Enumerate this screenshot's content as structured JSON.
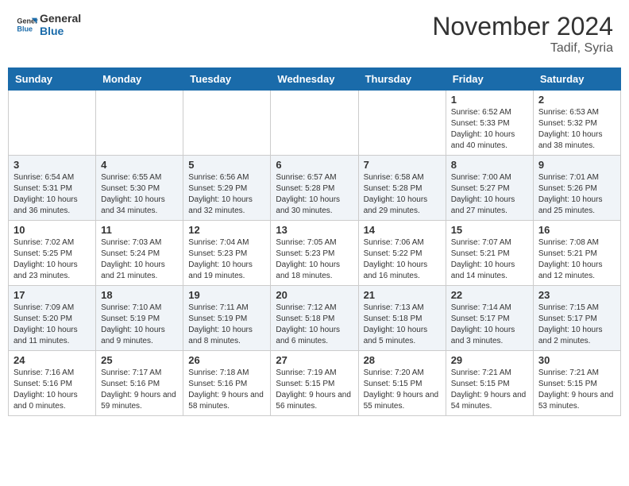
{
  "header": {
    "logo_line1": "General",
    "logo_line2": "Blue",
    "month": "November 2024",
    "location": "Tadif, Syria"
  },
  "weekdays": [
    "Sunday",
    "Monday",
    "Tuesday",
    "Wednesday",
    "Thursday",
    "Friday",
    "Saturday"
  ],
  "weeks": [
    [
      {
        "day": "",
        "info": ""
      },
      {
        "day": "",
        "info": ""
      },
      {
        "day": "",
        "info": ""
      },
      {
        "day": "",
        "info": ""
      },
      {
        "day": "",
        "info": ""
      },
      {
        "day": "1",
        "info": "Sunrise: 6:52 AM\nSunset: 5:33 PM\nDaylight: 10 hours and 40 minutes."
      },
      {
        "day": "2",
        "info": "Sunrise: 6:53 AM\nSunset: 5:32 PM\nDaylight: 10 hours and 38 minutes."
      }
    ],
    [
      {
        "day": "3",
        "info": "Sunrise: 6:54 AM\nSunset: 5:31 PM\nDaylight: 10 hours and 36 minutes."
      },
      {
        "day": "4",
        "info": "Sunrise: 6:55 AM\nSunset: 5:30 PM\nDaylight: 10 hours and 34 minutes."
      },
      {
        "day": "5",
        "info": "Sunrise: 6:56 AM\nSunset: 5:29 PM\nDaylight: 10 hours and 32 minutes."
      },
      {
        "day": "6",
        "info": "Sunrise: 6:57 AM\nSunset: 5:28 PM\nDaylight: 10 hours and 30 minutes."
      },
      {
        "day": "7",
        "info": "Sunrise: 6:58 AM\nSunset: 5:28 PM\nDaylight: 10 hours and 29 minutes."
      },
      {
        "day": "8",
        "info": "Sunrise: 7:00 AM\nSunset: 5:27 PM\nDaylight: 10 hours and 27 minutes."
      },
      {
        "day": "9",
        "info": "Sunrise: 7:01 AM\nSunset: 5:26 PM\nDaylight: 10 hours and 25 minutes."
      }
    ],
    [
      {
        "day": "10",
        "info": "Sunrise: 7:02 AM\nSunset: 5:25 PM\nDaylight: 10 hours and 23 minutes."
      },
      {
        "day": "11",
        "info": "Sunrise: 7:03 AM\nSunset: 5:24 PM\nDaylight: 10 hours and 21 minutes."
      },
      {
        "day": "12",
        "info": "Sunrise: 7:04 AM\nSunset: 5:23 PM\nDaylight: 10 hours and 19 minutes."
      },
      {
        "day": "13",
        "info": "Sunrise: 7:05 AM\nSunset: 5:23 PM\nDaylight: 10 hours and 18 minutes."
      },
      {
        "day": "14",
        "info": "Sunrise: 7:06 AM\nSunset: 5:22 PM\nDaylight: 10 hours and 16 minutes."
      },
      {
        "day": "15",
        "info": "Sunrise: 7:07 AM\nSunset: 5:21 PM\nDaylight: 10 hours and 14 minutes."
      },
      {
        "day": "16",
        "info": "Sunrise: 7:08 AM\nSunset: 5:21 PM\nDaylight: 10 hours and 12 minutes."
      }
    ],
    [
      {
        "day": "17",
        "info": "Sunrise: 7:09 AM\nSunset: 5:20 PM\nDaylight: 10 hours and 11 minutes."
      },
      {
        "day": "18",
        "info": "Sunrise: 7:10 AM\nSunset: 5:19 PM\nDaylight: 10 hours and 9 minutes."
      },
      {
        "day": "19",
        "info": "Sunrise: 7:11 AM\nSunset: 5:19 PM\nDaylight: 10 hours and 8 minutes."
      },
      {
        "day": "20",
        "info": "Sunrise: 7:12 AM\nSunset: 5:18 PM\nDaylight: 10 hours and 6 minutes."
      },
      {
        "day": "21",
        "info": "Sunrise: 7:13 AM\nSunset: 5:18 PM\nDaylight: 10 hours and 5 minutes."
      },
      {
        "day": "22",
        "info": "Sunrise: 7:14 AM\nSunset: 5:17 PM\nDaylight: 10 hours and 3 minutes."
      },
      {
        "day": "23",
        "info": "Sunrise: 7:15 AM\nSunset: 5:17 PM\nDaylight: 10 hours and 2 minutes."
      }
    ],
    [
      {
        "day": "24",
        "info": "Sunrise: 7:16 AM\nSunset: 5:16 PM\nDaylight: 10 hours and 0 minutes."
      },
      {
        "day": "25",
        "info": "Sunrise: 7:17 AM\nSunset: 5:16 PM\nDaylight: 9 hours and 59 minutes."
      },
      {
        "day": "26",
        "info": "Sunrise: 7:18 AM\nSunset: 5:16 PM\nDaylight: 9 hours and 58 minutes."
      },
      {
        "day": "27",
        "info": "Sunrise: 7:19 AM\nSunset: 5:15 PM\nDaylight: 9 hours and 56 minutes."
      },
      {
        "day": "28",
        "info": "Sunrise: 7:20 AM\nSunset: 5:15 PM\nDaylight: 9 hours and 55 minutes."
      },
      {
        "day": "29",
        "info": "Sunrise: 7:21 AM\nSunset: 5:15 PM\nDaylight: 9 hours and 54 minutes."
      },
      {
        "day": "30",
        "info": "Sunrise: 7:21 AM\nSunset: 5:15 PM\nDaylight: 9 hours and 53 minutes."
      }
    ]
  ]
}
